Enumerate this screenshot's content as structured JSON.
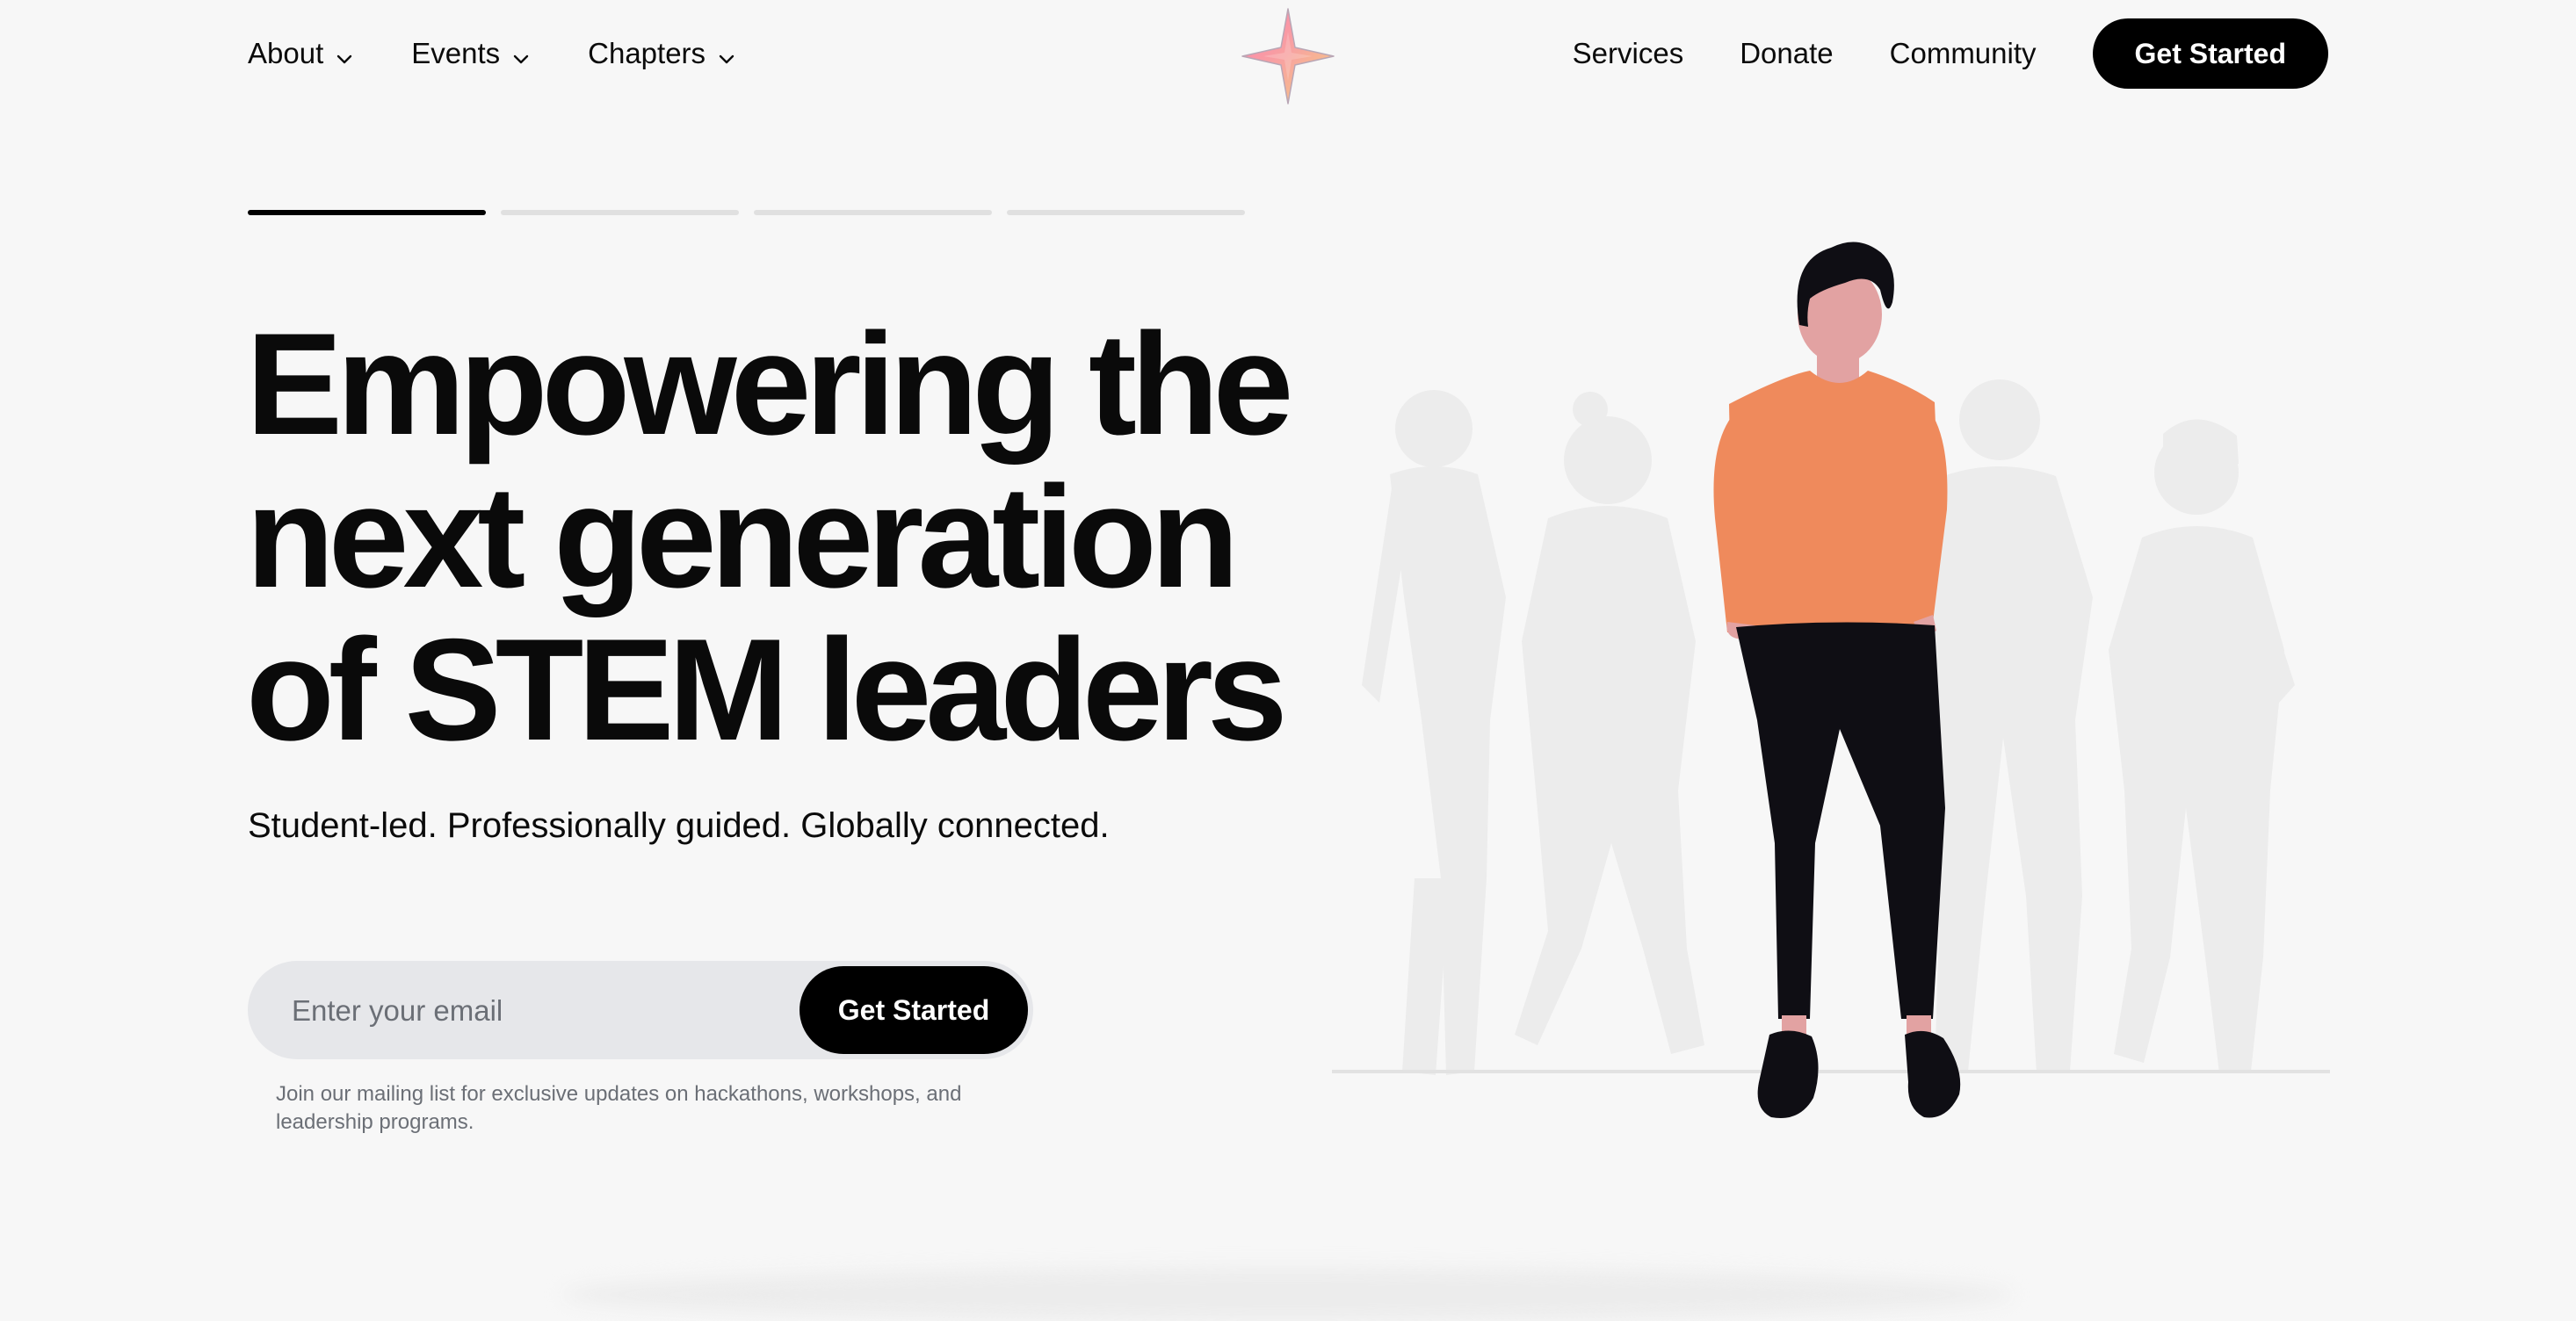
{
  "nav": {
    "dropdowns": [
      {
        "label": "About"
      },
      {
        "label": "Events"
      },
      {
        "label": "Chapters"
      }
    ],
    "links": [
      {
        "label": "Services"
      },
      {
        "label": "Donate"
      },
      {
        "label": "Community"
      }
    ],
    "cta_label": "Get Started",
    "logo_icon": "four-point-star-logo-icon"
  },
  "carousel": {
    "slide_count": 4,
    "active_index": 0
  },
  "hero": {
    "headline_lines": [
      "Empowering the",
      "next generation",
      "of STEM leaders"
    ],
    "subheadline": "Student-led. Professionally guided. Globally connected.",
    "email": {
      "placeholder": "Enter your email",
      "value": "",
      "button_label": "Get Started"
    },
    "note": "Join our mailing list for exclusive updates on hackathons, workshops, and leadership programs."
  },
  "colors": {
    "background": "#f7f7f7",
    "primary": "#000000",
    "shirt": "#ef8a5c",
    "skin": "#e2a2a2",
    "pants": "#0f0e14",
    "silhouette": "#ededed",
    "input_bg": "#e6e7ea",
    "muted_text": "#6b6f76"
  }
}
